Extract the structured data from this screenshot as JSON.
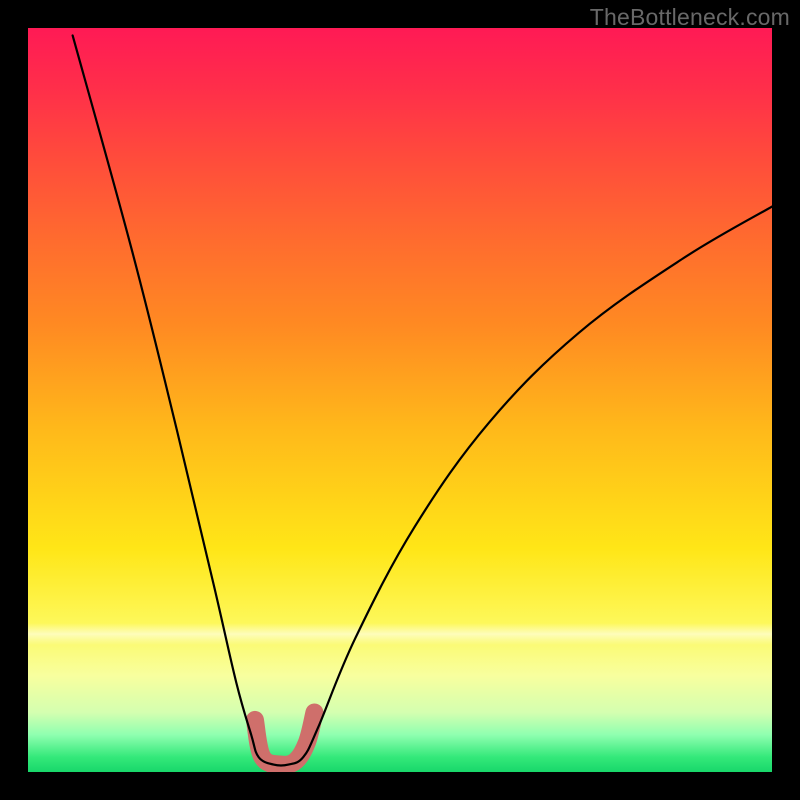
{
  "watermark": {
    "text": "TheBottleneck.com"
  },
  "chart_data": {
    "type": "line",
    "title": "",
    "xlabel": "",
    "ylabel": "",
    "xlim": [
      0,
      100
    ],
    "ylim": [
      0,
      100
    ],
    "grid": false,
    "legend": false,
    "background": {
      "type": "vertical-gradient",
      "stops": [
        {
          "pct": 0,
          "color": "#ff1a55"
        },
        {
          "pct": 70,
          "color": "#ffe617"
        },
        {
          "pct": 100,
          "color": "#18d76a"
        }
      ]
    },
    "series": [
      {
        "name": "bottleneck-curve",
        "color": "#000000",
        "width": 2.2,
        "points": [
          {
            "x": 6,
            "y": 99
          },
          {
            "x": 14,
            "y": 70
          },
          {
            "x": 20,
            "y": 46
          },
          {
            "x": 25,
            "y": 25
          },
          {
            "x": 28,
            "y": 12
          },
          {
            "x": 30,
            "y": 5
          },
          {
            "x": 31,
            "y": 2
          },
          {
            "x": 33,
            "y": 1
          },
          {
            "x": 35,
            "y": 1
          },
          {
            "x": 37,
            "y": 2
          },
          {
            "x": 39,
            "y": 6
          },
          {
            "x": 44,
            "y": 18
          },
          {
            "x": 52,
            "y": 33
          },
          {
            "x": 62,
            "y": 47
          },
          {
            "x": 74,
            "y": 59
          },
          {
            "x": 88,
            "y": 69
          },
          {
            "x": 100,
            "y": 76
          }
        ]
      },
      {
        "name": "highlight-bottom",
        "color": "#cf6f6b",
        "width": 18,
        "points": [
          {
            "x": 30.5,
            "y": 7
          },
          {
            "x": 31.5,
            "y": 2
          },
          {
            "x": 34,
            "y": 1
          },
          {
            "x": 36,
            "y": 1.5
          },
          {
            "x": 37.5,
            "y": 4
          },
          {
            "x": 38.5,
            "y": 8
          }
        ]
      }
    ]
  }
}
